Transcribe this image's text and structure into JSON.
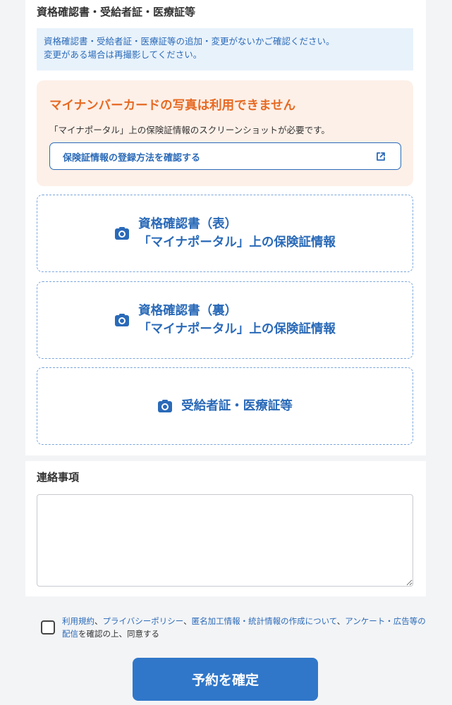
{
  "docs_section": {
    "heading": "資格確認書・受給者証・医療証等",
    "info_line1": "資格確認書・受給者証・医療証等の追加・変更がないかご確認ください。",
    "info_line2": "変更がある場合は再撮影してください。",
    "warning": {
      "title": "マイナンバーカードの写真は利用できません",
      "text": "「マイナポータル」上の保険証情報のスクリーンショットが必要です。",
      "link_label": "保険証情報の登録方法を確認する",
      "link_icon": "external-link-icon"
    },
    "uploads": [
      {
        "line1": "資格確認書（表）",
        "line2": "「マイナポータル」上の保険証情報",
        "icon": "camera-icon"
      },
      {
        "line1": "資格確認書（裏）",
        "line2": "「マイナポータル」上の保険証情報",
        "icon": "camera-icon"
      },
      {
        "line1": "受給者証・医療証等",
        "icon": "camera-icon"
      }
    ]
  },
  "notes_section": {
    "heading": "連絡事項",
    "value": ""
  },
  "agreement": {
    "link_terms": "利用規約",
    "sep1": "、",
    "link_privacy": "プライバシーポリシー",
    "sep2": "、",
    "link_anon": "匿名加工情報・統計情報の作成について",
    "sep3": "、",
    "link_survey": "アンケート・広告等の配信",
    "suffix": "を確認の上、同意する",
    "checked": false
  },
  "confirm_button": {
    "label": "予約を確定"
  },
  "colors": {
    "accent": "#2a6ab8",
    "button": "#3077c9",
    "warning_title": "#e66a23",
    "warning_bg": "#fdf0e8",
    "info_bg": "#e8f2fb"
  }
}
